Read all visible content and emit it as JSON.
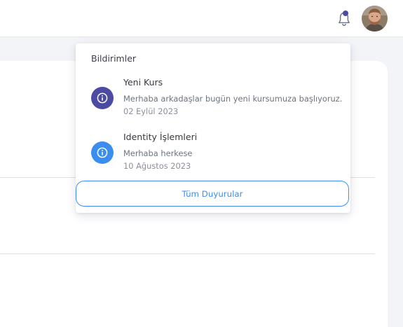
{
  "header": {
    "bell_icon": "bell-icon",
    "has_unread": true,
    "unread_dot_color": "#4b4ba1",
    "avatar_icon": "user-avatar"
  },
  "notifications_panel": {
    "title": "Bildirimler",
    "items": [
      {
        "title": "Yeni Kurs",
        "message": "Merhaba arkadaşlar bugün yeni kursumuza başlıyoruz.",
        "date": "02 Eylül 2023",
        "icon": "info-icon",
        "icon_color": "#4b4ba1"
      },
      {
        "title": "Identity İşlemleri",
        "message": "Merhaba herkese",
        "date": "10 Ağustos 2023",
        "icon": "info-icon",
        "icon_color": "#3b8ef0"
      }
    ],
    "all_button_label": "Tüm Duyurular",
    "accent_color": "#3b8ef0"
  }
}
